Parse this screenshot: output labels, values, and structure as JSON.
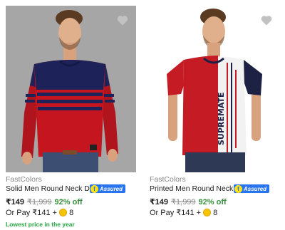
{
  "products": [
    {
      "brand": "FastColors",
      "title": "Solid Men Round Neck Dar…",
      "assured": "Assured",
      "price": "₹149",
      "mrp": "₹1,999",
      "discount": "92% off",
      "pay_prefix": "Or Pay",
      "pay_amount": "₹141 +",
      "coins": "8",
      "tag": "Lowest price in the year",
      "image_icon": "red-navy-striped-tshirt-model-image",
      "wishlist_icon": "heart-icon"
    },
    {
      "brand": "FastColors",
      "title": "Printed Men Round Neck R…",
      "assured": "Assured",
      "price": "₹149",
      "mrp": "₹1,999",
      "discount": "92% off",
      "pay_prefix": "Or Pay",
      "pay_amount": "₹141 +",
      "coins": "8",
      "image_icon": "red-white-printed-tshirt-model-image",
      "wishlist_icon": "heart-icon"
    }
  ],
  "colors": {
    "assured_blue": "#2874f0",
    "discount_green": "#388e3c",
    "tag_green": "#26a541",
    "muted_gray": "#878787"
  }
}
